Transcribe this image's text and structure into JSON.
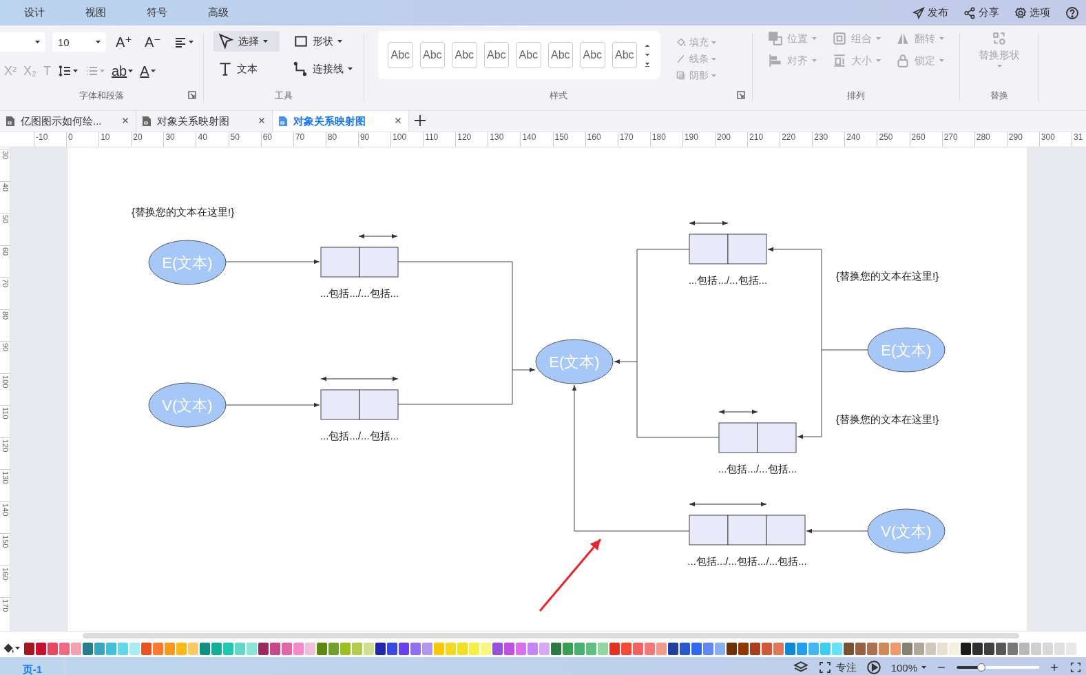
{
  "menu_tabs": [
    {
      "label": "设计",
      "selected": false
    },
    {
      "label": "视图",
      "selected": false
    },
    {
      "label": "符号",
      "selected": false
    },
    {
      "label": "高级",
      "selected": false
    }
  ],
  "top_actions": [
    {
      "label": "发布"
    },
    {
      "label": "分享"
    },
    {
      "label": "选项"
    }
  ],
  "font_group": {
    "font_size": "10",
    "label": "字体和段落",
    "row1": [
      {
        "glyph": "A⁺",
        "disabled": false
      },
      {
        "glyph": "A⁻",
        "disabled": false
      }
    ],
    "row2_left": [
      {
        "glyph": "X²",
        "disabled": true
      },
      {
        "glyph": "X₂",
        "disabled": true
      },
      {
        "glyph": "T",
        "disabled": true
      }
    ],
    "row2_right": [
      {
        "glyph": "ab",
        "disabled": false
      },
      {
        "glyph": "A",
        "disabled": false
      }
    ]
  },
  "tools_group": {
    "label": "工具",
    "tools": [
      {
        "label": "选择",
        "selected": true
      },
      {
        "label": "形状",
        "selected": false
      },
      {
        "label": "文本",
        "selected": false
      },
      {
        "label": "连接线",
        "selected": false
      }
    ]
  },
  "style_group": {
    "label": "样式",
    "gallery": [
      "Abc",
      "Abc",
      "Abc",
      "Abc",
      "Abc",
      "Abc",
      "Abc",
      "Abc"
    ],
    "shape_props": [
      {
        "label": "填充",
        "disabled": true
      },
      {
        "label": "线条",
        "disabled": true
      },
      {
        "label": "阴影",
        "disabled": true
      }
    ]
  },
  "arrange_group": {
    "label": "排列",
    "items": [
      {
        "label": "位置",
        "disabled": true
      },
      {
        "label": "组合",
        "disabled": true
      },
      {
        "label": "翻转",
        "disabled": true
      },
      {
        "label": "对齐",
        "disabled": true
      },
      {
        "label": "大小",
        "disabled": true
      },
      {
        "label": "锁定",
        "disabled": true
      }
    ]
  },
  "replace_group": {
    "label": "替换",
    "button": "替换形状",
    "disabled": true
  },
  "doc_tabs": [
    {
      "title": "亿图图示如何绘...",
      "selected": false
    },
    {
      "title": "对象关系映射图",
      "selected": false
    },
    {
      "title": "对象关系映射图",
      "selected": true
    }
  ],
  "rulers": {
    "horizontal": [
      "-10",
      "0",
      "10",
      "20",
      "30",
      "40",
      "50",
      "60",
      "70",
      "80",
      "90",
      "100",
      "110",
      "120",
      "130",
      "140",
      "150",
      "160",
      "170",
      "180",
      "190",
      "200",
      "210",
      "220",
      "230",
      "240",
      "250",
      "260",
      "270",
      "280",
      "290",
      "300",
      "31"
    ],
    "vertical": [
      "30",
      "40",
      "50",
      "60",
      "70",
      "80",
      "90",
      "100",
      "110",
      "120",
      "130",
      "140",
      "150",
      "160",
      "170"
    ]
  },
  "diagram": {
    "notes": [
      "{替换您的文本在这里!}",
      "{替换您的文本在这里!}",
      "{替换您的文本在这里!}"
    ],
    "entities": [
      "E(文本)",
      "V(文本)",
      "E(文本)",
      "E(文本)",
      "V(文本)"
    ],
    "mappings": [
      {
        "kind": "pair",
        "label": "...包括.../...包括..."
      },
      {
        "kind": "pair",
        "label": "...包括.../...包括..."
      },
      {
        "kind": "pair",
        "label": "...包括.../...包括..."
      },
      {
        "kind": "pair",
        "label": "...包括.../...包括..."
      },
      {
        "kind": "triple",
        "label": "...包括.../...包括.../...包括..."
      }
    ]
  },
  "palette": [
    {
      "color": "#a8151e"
    },
    {
      "color": "#c8102e"
    },
    {
      "color": "#e84860"
    },
    {
      "color": "#f06a80"
    },
    {
      "color": "#f5a0b0"
    },
    {
      "color": "#267e8e"
    },
    {
      "color": "#38a6c0"
    },
    {
      "color": "#40c0dc"
    },
    {
      "color": "#60d8ec"
    },
    {
      "color": "#a8ecf8"
    },
    {
      "color": "#f05020"
    },
    {
      "color": "#ff7a30"
    },
    {
      "color": "#ff9a18"
    },
    {
      "color": "#ffb818"
    },
    {
      "color": "#ffc860"
    },
    {
      "color": "#109080"
    },
    {
      "color": "#10b098"
    },
    {
      "color": "#20c8b0"
    },
    {
      "color": "#60d8c8"
    },
    {
      "color": "#88e8d8"
    },
    {
      "color": "#9c2860"
    },
    {
      "color": "#c84888"
    },
    {
      "color": "#e068a8"
    },
    {
      "color": "#f488c8"
    },
    {
      "color": "#f0c0d8"
    },
    {
      "color": "#5c8810"
    },
    {
      "color": "#70a028"
    },
    {
      "color": "#98c020"
    },
    {
      "color": "#b0cc48"
    },
    {
      "color": "#d0e090"
    },
    {
      "color": "#2028b0"
    },
    {
      "color": "#3848e0"
    },
    {
      "color": "#6840f0"
    },
    {
      "color": "#9070f0"
    },
    {
      "color": "#b098f0"
    },
    {
      "color": "#f8c800"
    },
    {
      "color": "#f8d820"
    },
    {
      "color": "#f0e020"
    },
    {
      "color": "#f8f040"
    },
    {
      "color": "#f8f880"
    },
    {
      "color": "#9850e0"
    },
    {
      "color": "#c050e0"
    },
    {
      "color": "#d870f0"
    },
    {
      "color": "#c088f0"
    },
    {
      "color": "#d8a8f8"
    },
    {
      "color": "#2c7a40"
    },
    {
      "color": "#38a050"
    },
    {
      "color": "#48b070"
    },
    {
      "color": "#60c080"
    },
    {
      "color": "#90d8a0"
    },
    {
      "color": "#e83020"
    },
    {
      "color": "#f84838"
    },
    {
      "color": "#f86060"
    },
    {
      "color": "#f87878"
    },
    {
      "color": "#f89888"
    },
    {
      "color": "#2040a0"
    },
    {
      "color": "#2858d0"
    },
    {
      "color": "#3068f0"
    },
    {
      "color": "#6088f8"
    },
    {
      "color": "#88b0f0"
    },
    {
      "color": "#703000"
    },
    {
      "color": "#903800"
    },
    {
      "color": "#a84020"
    },
    {
      "color": "#d05838"
    },
    {
      "color": "#e07858"
    },
    {
      "color": "#1088d8"
    },
    {
      "color": "#20a0f0"
    },
    {
      "color": "#40b8f8"
    },
    {
      "color": "#38d0f8"
    },
    {
      "color": "#68e0f8"
    },
    {
      "color": "#7a5030"
    },
    {
      "color": "#986040"
    },
    {
      "color": "#b07050"
    },
    {
      "color": "#d08858"
    },
    {
      "color": "#f09868"
    },
    {
      "color": "#888070"
    },
    {
      "color": "#b0a898"
    },
    {
      "color": "#d0c8b8"
    },
    {
      "color": "#e8e0d0"
    },
    {
      "color": "#f4f0e0"
    },
    {
      "color": "#1a1a1a"
    },
    {
      "color": "#303030"
    },
    {
      "color": "#404040"
    },
    {
      "color": "#585858"
    },
    {
      "color": "#787878"
    },
    {
      "color": "#b8b8b8"
    },
    {
      "color": "#d0d0d0"
    },
    {
      "color": "#d8d8d8"
    },
    {
      "color": "#e0e0e0"
    },
    {
      "color": "#e8e8e8"
    }
  ],
  "status_bar": {
    "pages": [
      {
        "label": "页-1",
        "selected": true
      }
    ],
    "focus": "专注",
    "zoom": "100%",
    "zoom_slider": {
      "level": 0.3
    }
  }
}
